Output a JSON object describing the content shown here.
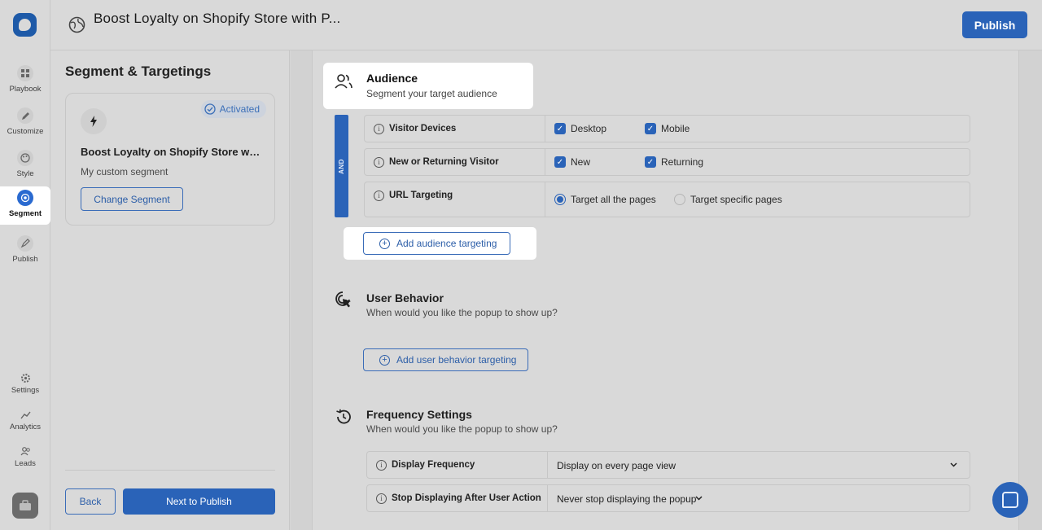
{
  "topbar": {
    "title": "Boost Loyalty on Shopify Store with P...",
    "publish_label": "Publish"
  },
  "rail": {
    "items": [
      {
        "label": "Playbook",
        "icon": "grid-icon"
      },
      {
        "label": "Customize",
        "icon": "pencil-icon"
      },
      {
        "label": "Style",
        "icon": "palette-icon"
      },
      {
        "label": "Segment",
        "icon": "target-icon"
      },
      {
        "label": "Publish",
        "icon": "rocket-icon"
      }
    ],
    "bottom": [
      {
        "label": "Settings",
        "icon": "gear-icon"
      },
      {
        "label": "Analytics",
        "icon": "chart-icon"
      },
      {
        "label": "Leads",
        "icon": "users-icon"
      }
    ]
  },
  "left_panel": {
    "title": "Segment & Targetings",
    "card": {
      "status": "Activated",
      "name": "Boost Loyalty on Shopify Store with Popups",
      "subtitle": "My custom segment",
      "change_label": "Change Segment"
    },
    "back_label": "Back",
    "next_label": "Next to Publish"
  },
  "audience": {
    "title": "Audience",
    "subtitle": "Segment your target audience",
    "and_label": "AND",
    "rows": [
      {
        "label": "Visitor Devices",
        "options": [
          "Desktop",
          "Mobile"
        ]
      },
      {
        "label": "New or Returning Visitor",
        "options": [
          "New",
          "Returning"
        ]
      },
      {
        "label": "URL Targeting",
        "options": [
          "Target all the pages",
          "Target specific pages"
        ]
      }
    ],
    "add_label": "Add audience targeting"
  },
  "behavior": {
    "title": "User Behavior",
    "subtitle": "When would you like the popup to show up?",
    "add_label": "Add user behavior targeting"
  },
  "frequency": {
    "title": "Frequency Settings",
    "subtitle": "When would you like the popup to show up?",
    "rows": [
      {
        "label": "Display Frequency",
        "value": "Display on every page view"
      },
      {
        "label": "Stop Displaying After User Action",
        "value": "Never stop displaying the popup"
      }
    ]
  },
  "colors": {
    "accent": "#2a63b8"
  }
}
